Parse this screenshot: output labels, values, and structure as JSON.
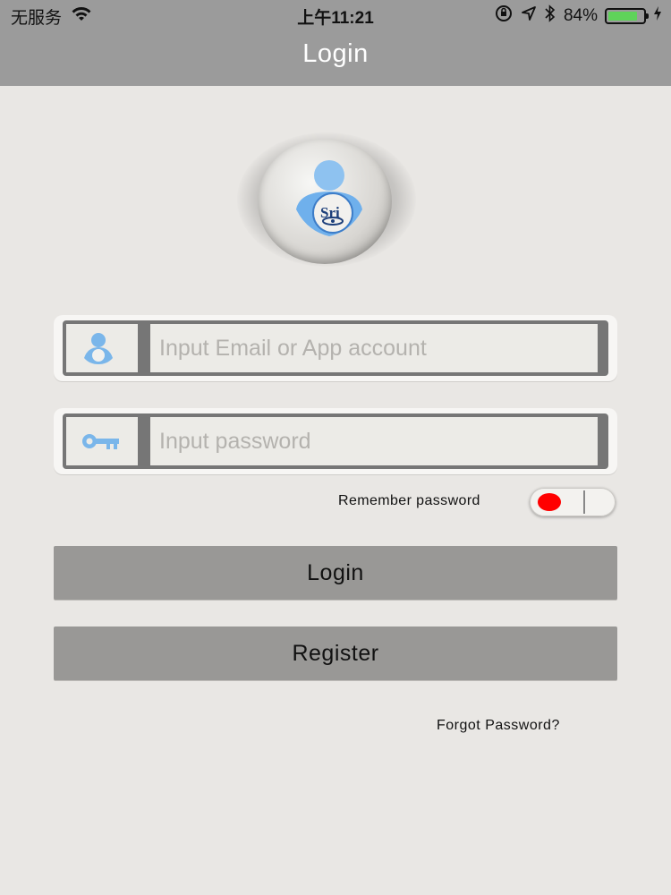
{
  "status_bar": {
    "carrier": "无服务",
    "time": "上午11:21",
    "battery_percent": "84%",
    "battery_level": 0.84,
    "icons": [
      "wifi-icon",
      "orientation-lock-icon",
      "location-icon",
      "bluetooth-icon",
      "battery-icon",
      "charging-icon"
    ]
  },
  "nav": {
    "title": "Login"
  },
  "logo": {
    "text": "Sri"
  },
  "form": {
    "account_placeholder": "Input Email or App account",
    "account_value": "",
    "account_icon": "user-icon",
    "password_placeholder": "Input password",
    "password_value": "",
    "password_icon": "key-icon",
    "remember_label": "Remember password",
    "remember_on": false
  },
  "actions": {
    "login_label": "Login",
    "register_label": "Register",
    "forgot_label": "Forgot Password?"
  },
  "colors": {
    "nav_bg": "#9b9b9b",
    "page_bg": "#e9e7e4",
    "button_bg": "#999896",
    "toggle_knob": "#ff0000",
    "icon_blue": "#7ab6ea"
  }
}
